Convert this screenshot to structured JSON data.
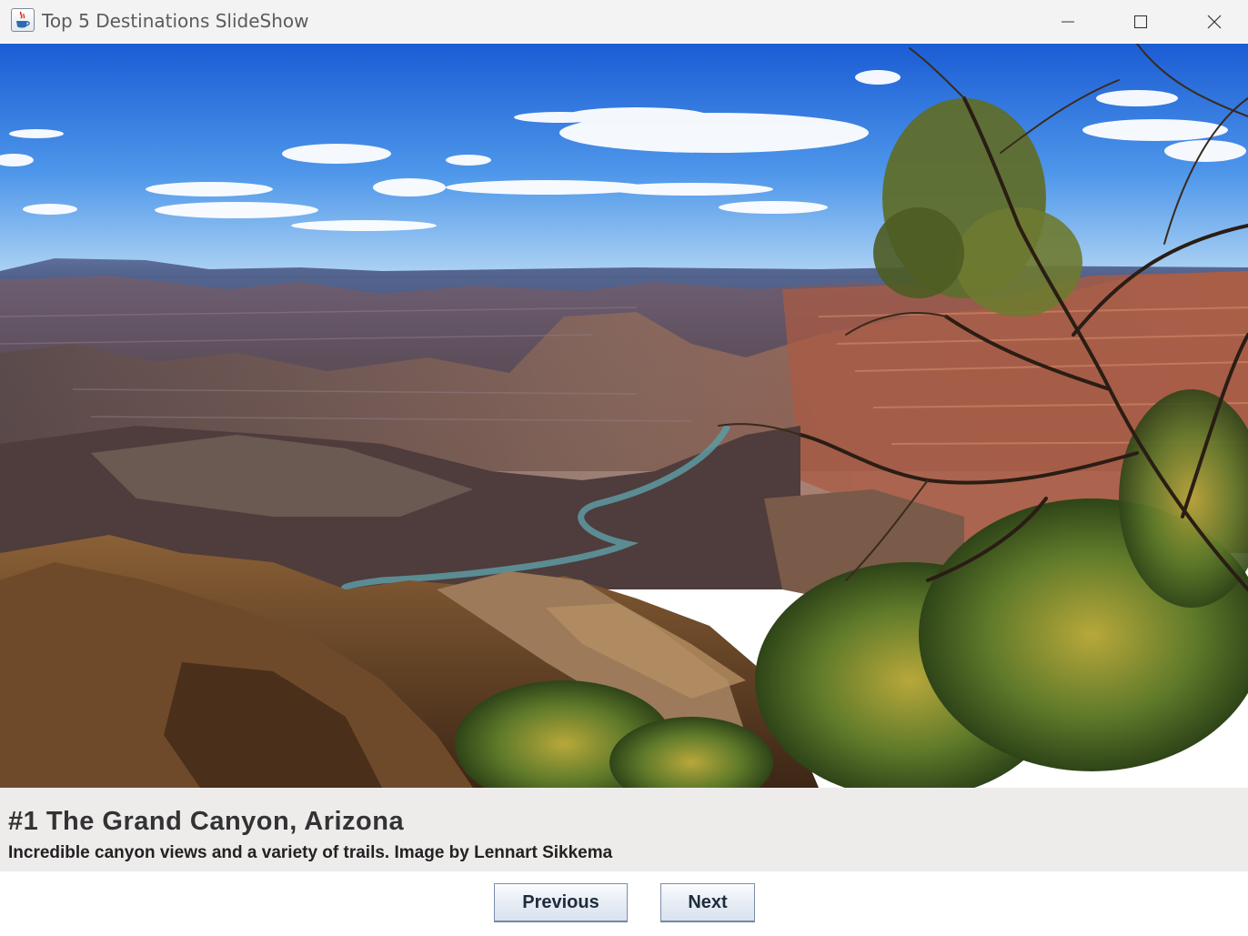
{
  "window": {
    "title": "Top 5 Destinations SlideShow",
    "icon": "java-cup-icon",
    "controls": [
      "minimize-icon",
      "maximize-icon",
      "close-icon"
    ]
  },
  "slide": {
    "image_alt": "Grand Canyon landscape with blue sky and tree",
    "title": "#1 The Grand Canyon, Arizona",
    "description": "Incredible canyon views and a variety of trails. Image by Lennart Sikkema"
  },
  "buttons": {
    "previous_label": "Previous",
    "next_label": "Next"
  },
  "colors": {
    "titlebar": "#f3f3f3",
    "caption_bg": "#eeebeb",
    "button_border": "#7a8ea8",
    "sky_top": "#1a5fd6",
    "sky_bottom": "#9ccbf3"
  }
}
